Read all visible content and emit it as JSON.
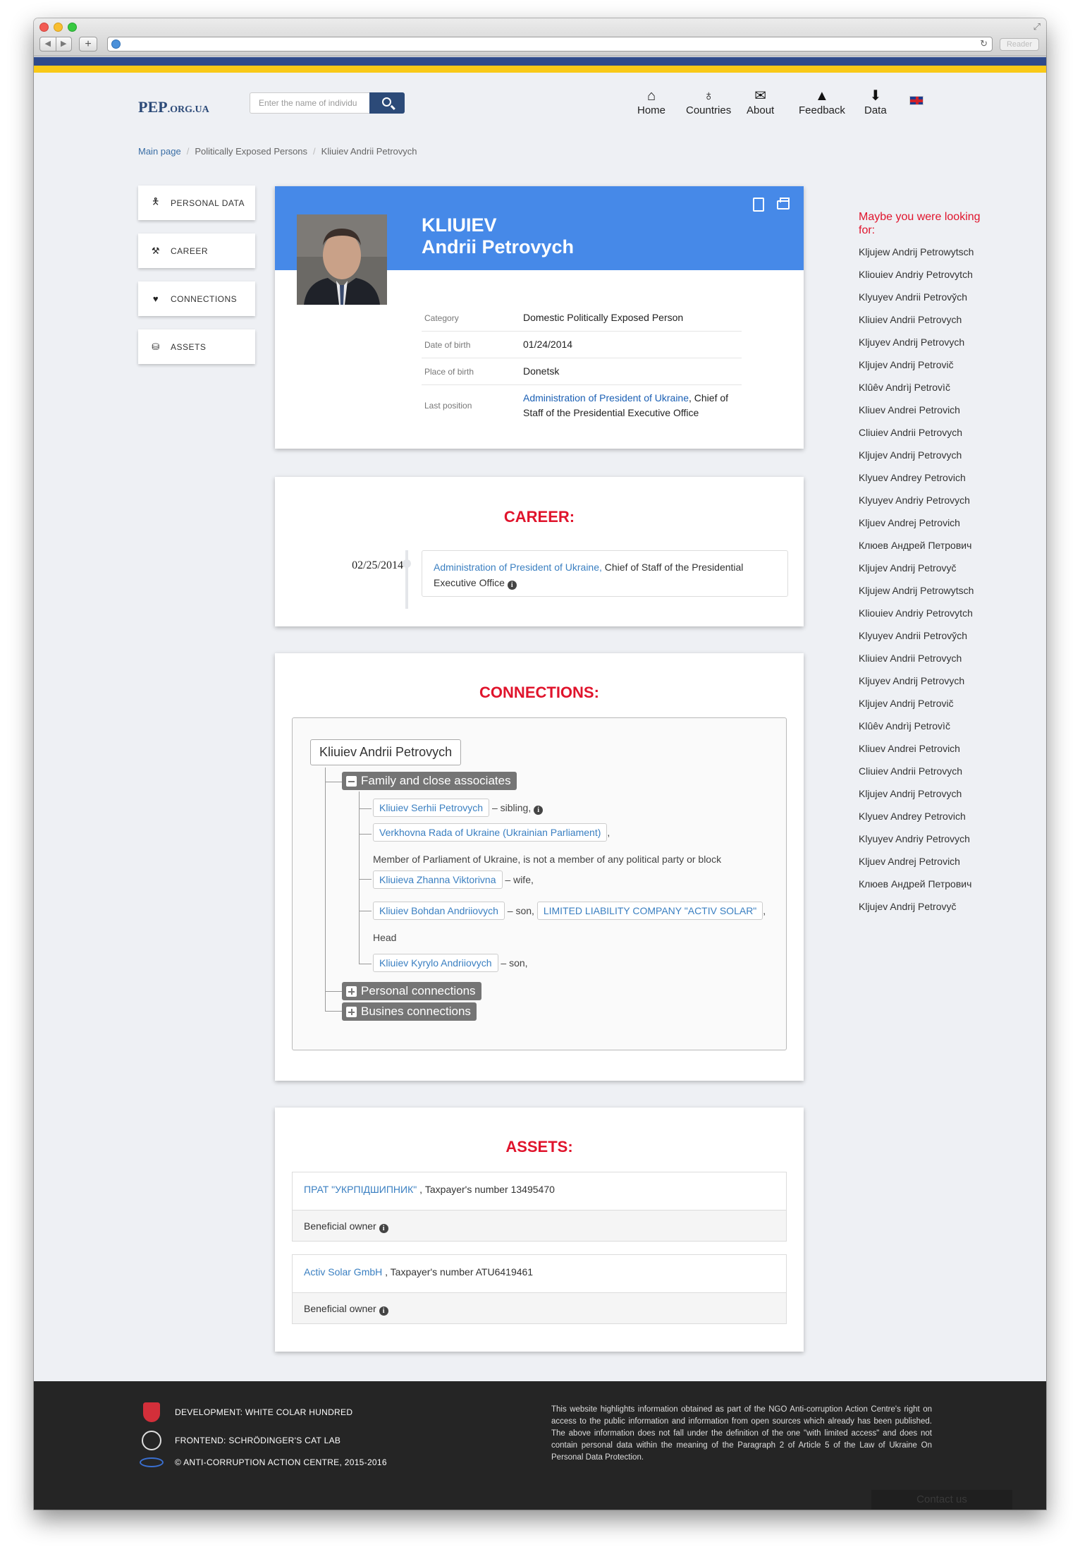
{
  "browser": {
    "reader_label": "Reader",
    "url": ""
  },
  "header": {
    "logo_main": "PEP",
    "logo_domain": ".ORG.UA",
    "search_placeholder": "Enter the name of individu",
    "nav": {
      "home": "Home",
      "countries": "Countries",
      "about": "About",
      "feedback": "Feedback",
      "data": "Data"
    },
    "language": "uk-flag"
  },
  "breadcrumb": {
    "item1": "Main page",
    "item2": "Politically Exposed Persons",
    "item3": "Kliuiev Andrii Petrovych"
  },
  "leftnav": {
    "personal_data": "PERSONAL DATA",
    "career": "CAREER",
    "connections": "CONNECTIONS",
    "assets": "ASSETS"
  },
  "profile": {
    "surname": "KLIUIEV",
    "given_names": "Andrii Petrovych",
    "category_label": "Category",
    "category_value": "Domestic Politically Exposed Person",
    "dob_label": "Date of birth",
    "dob_value": "01/24/2014",
    "pob_label": "Place of birth",
    "pob_value": "Donetsk",
    "position_label": "Last position",
    "position_org": "Administration of President of Ukraine",
    "position_role": ", Chief of Staff of the Presidential Executive Office"
  },
  "career": {
    "title": "CAREER:",
    "date": "02/25/2014",
    "org": "Administration of President of Ukraine,",
    "role": " Chief of Staff of the Presidential Executive Office "
  },
  "connections": {
    "title": "CONNECTIONS:",
    "root": "Kliuiev Andrii Petrovych",
    "group_family": "Family and close associates",
    "group_personal": "Personal connections",
    "group_business": "Busines connections",
    "c1_name": "Kliuiev Serhii Petrovych",
    "c1_rel": " – sibling, ",
    "c2_name": "Verkhovna Rada of Ukraine (Ukrainian Parliament)",
    "c2_after": ",",
    "c2_desc": "Member of Parliament of Ukraine, is not a member of any political party or block",
    "c3_name": "Kliuieva Zhanna Viktorivna",
    "c3_rel": " – wife,",
    "c4_name": "Kliuiev Bohdan Andriiovych",
    "c4_rel": " – son, ",
    "c4_company": "LIMITED LIABILITY COMPANY \"ACTIV SOLAR\"",
    "c4_after": ",",
    "c4_role": "Head",
    "c5_name": "Kliuiev Kyrylo Andriiovych",
    "c5_rel": " – son,"
  },
  "assets": {
    "title": "ASSETS:",
    "a1_name": "ПРАТ \"УКРПІДШИПНИК\"",
    "a1_tax": " , Taxpayer's number 13495470",
    "a1_role": "Beneficial owner ",
    "a2_name": "Activ Solar GmbH",
    "a2_tax": " , Taxpayer's number ATU6419461",
    "a2_role": "Beneficial owner "
  },
  "aside": {
    "heading": "Maybe you were looking for:",
    "suggestions": [
      "Kljujew Andrij Petrowytsch",
      "Kliouiev Andriy Petrovytch",
      "Klyuyev Andrіі Petrovy̌ch",
      "Kliuiev Andrii Petrovych",
      "Kljuyev Andrij Petrovych",
      "Kljujev Andrij Petrovič",
      "Klûêv Andrìj Petrovìč",
      "Kliuev Andrei Petrovich",
      "Cliuiev Andrii Petrovych",
      "Kljujev Andrij Petrovych",
      "Klyuev Andrey Petrovich",
      "Klyuyev Andriy Petrovych",
      "Kljuev Andrej Petrovich",
      "Клюев Андрей Петрович",
      "Kljujev Andrij Petrovyč",
      "Kljujew Andrij Petrowytsch",
      "Kliouiev Andriy Petrovytch",
      "Klyuyev Andrіі Petrovy̌ch",
      "Kliuiev Andrii Petrovych",
      "Kljuyev Andrij Petrovych",
      "Kljujev Andrij Petrovič",
      "Klûêv Andrìj Petrovìč",
      "Kliuev Andrei Petrovich",
      "Cliuiev Andrii Petrovych",
      "Kljujev Andrij Petrovych",
      "Klyuev Andrey Petrovich",
      "Klyuyev Andriy Petrovych",
      "Kljuev Andrej Petrovich",
      "Клюев Андрей Петрович",
      "Kljujev Andrij Petrovyč"
    ]
  },
  "footer": {
    "dev": "DEVELOPMENT: WHITE COLAR HUNDRED",
    "frontend": "FRONTEND: SCHRÖDINGER'S CAT LAB",
    "copyright": "© ANTI-CORRUPTION ACTION CENTRE, 2015-2016",
    "disclaimer": "This website highlights information obtained as part of the NGO Anti-corruption Action Centre's right on access to the public information and information from open sources which already has been published. The above information does not fall under the definition of the one \"with limited access\" and does not contain personal data within the meaning of the Paragraph 2 of Article 5 of the Law of Ukraine On Personal Data Protection.",
    "contact": "Contact us"
  },
  "colors": {
    "flag_blue": "#2f4a8a",
    "flag_yellow": "#f9c917",
    "profile_header": "#4689e8",
    "section_title": "#e0142c",
    "link": "#3a7fc1"
  }
}
